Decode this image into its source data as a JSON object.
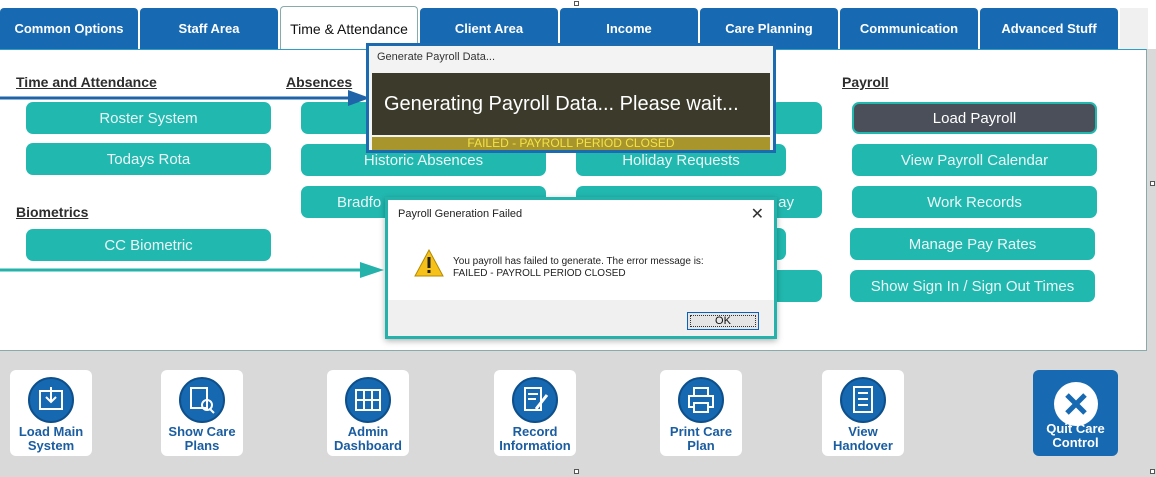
{
  "tabs": [
    {
      "label": "Common Options"
    },
    {
      "label": "Staff Area"
    },
    {
      "label": "Time & Attendance"
    },
    {
      "label": "Client Area"
    },
    {
      "label": "Income"
    },
    {
      "label": "Care Planning"
    },
    {
      "label": "Communication"
    },
    {
      "label": "Advanced Stuff"
    }
  ],
  "sections": {
    "time_attendance": {
      "heading": "Time and Attendance",
      "buttons": [
        "Roster System",
        "Todays Rota"
      ]
    },
    "biometrics": {
      "heading": "Biometrics",
      "buttons": [
        "CC Biometric"
      ]
    },
    "absences": {
      "heading": "Absences",
      "buttons": [
        "Historic Absences",
        "Bradfo"
      ]
    },
    "holidays": {
      "buttons": [
        "Holiday Requests",
        "ay"
      ]
    },
    "payroll": {
      "heading": "Payroll",
      "buttons": [
        "Load Payroll",
        "View Payroll Calendar",
        "Work Records",
        "Manage Pay Rates",
        "Show Sign In / Sign Out Times"
      ]
    }
  },
  "generate_window": {
    "title": "Generate Payroll Data...",
    "message": "Generating Payroll Data...  Please wait...",
    "status": "FAILED - PAYROLL PERIOD CLOSED"
  },
  "error_dialog": {
    "title": "Payroll Generation Failed",
    "close": "✕",
    "line1": "You payroll has failed to generate.  The error message is:",
    "line2": "FAILED - PAYROLL PERIOD CLOSED",
    "ok_label": "OK"
  },
  "toolbar": [
    {
      "label1": "Load Main",
      "label2": "System"
    },
    {
      "label1": "Show Care",
      "label2": "Plans"
    },
    {
      "label1": "Admin",
      "label2": "Dashboard"
    },
    {
      "label1": "Record",
      "label2": "Information"
    },
    {
      "label1": "Print Care",
      "label2": "Plan"
    },
    {
      "label1": "View",
      "label2": "Handover"
    }
  ],
  "quit": {
    "label1": "Quit Care",
    "label2": "Control"
  },
  "colors": {
    "tab_blue": "#1769b1",
    "teal": "#21b8b0",
    "dark_button": "#4b4f59",
    "status_yellow": "#a8952b"
  }
}
